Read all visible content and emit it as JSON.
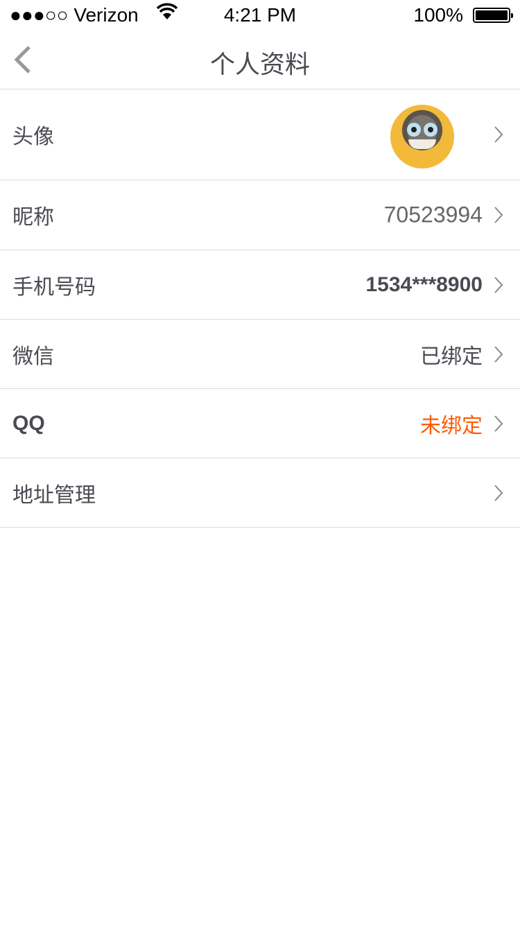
{
  "status_bar": {
    "carrier": "●●●○○ Verizon",
    "time": "4:21 PM",
    "battery": "100%",
    "battery_level": 1.0
  },
  "nav": {
    "title": "个人资料",
    "back_icon": "chevron-left-icon"
  },
  "rows": [
    {
      "label": "头像",
      "value": "",
      "type": "avatar"
    },
    {
      "label": "昵称",
      "value": "70523994"
    },
    {
      "label": "手机号码",
      "value": "1534***8900"
    },
    {
      "label": "微信",
      "value": "已绑定"
    },
    {
      "label": "QQ",
      "value": "未绑定",
      "value_color": "#ff5a00"
    },
    {
      "label": "地址管理",
      "value": ""
    }
  ],
  "colors": {
    "text": "#4a4a52",
    "accent": "#ff5a00",
    "divider": "#dcdcdc"
  }
}
